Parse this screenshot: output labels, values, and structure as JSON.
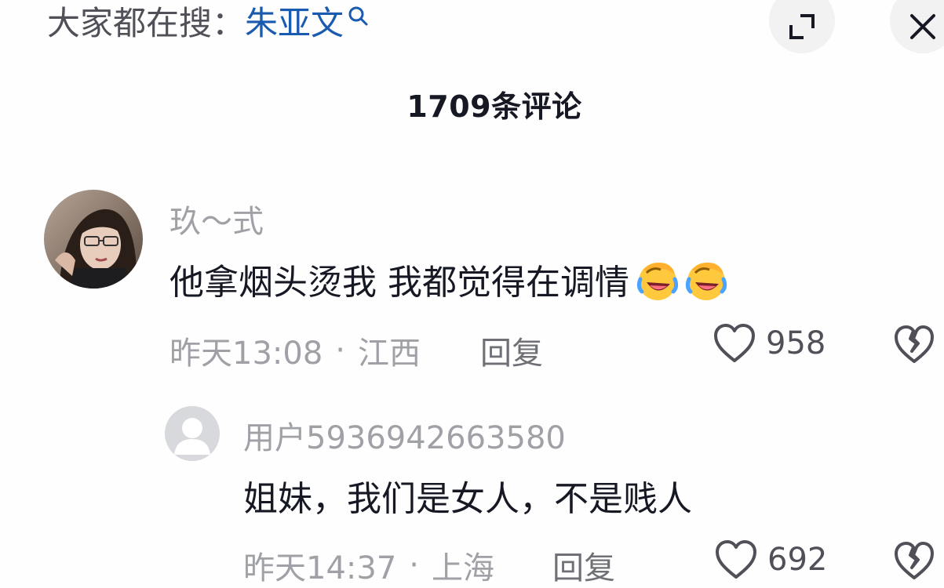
{
  "search": {
    "prefix": "大家都在搜：",
    "term": "朱亚文"
  },
  "header": {
    "comment_count": "1709条评论"
  },
  "comments": [
    {
      "username": "玖～式",
      "content": "他拿烟头烫我 我都觉得在调情",
      "emojis": [
        "laughing-crying-emoji",
        "laughing-crying-emoji"
      ],
      "time": "昨天13:08",
      "separator": "·",
      "location": "江西",
      "reply_label": "回复",
      "likes": "958"
    }
  ],
  "replies": [
    {
      "username": "用户5936942663580",
      "content": "姐妹，我们是女人，不是贱人",
      "time": "昨天14:37",
      "separator": "·",
      "location": "上海",
      "reply_label": "回复",
      "likes": "692"
    }
  ],
  "icons": {
    "search_hint": "search-icon",
    "expand": "expand-icon",
    "close": "close-icon",
    "like": "heart-icon",
    "dislike": "broken-heart-icon",
    "default_avatar": "default-user-avatar"
  },
  "colors": {
    "search_term": "#1a5bb0",
    "muted_text": "#a0a1a6",
    "primary_text": "#161823",
    "button_bg": "#f2f2f2"
  }
}
